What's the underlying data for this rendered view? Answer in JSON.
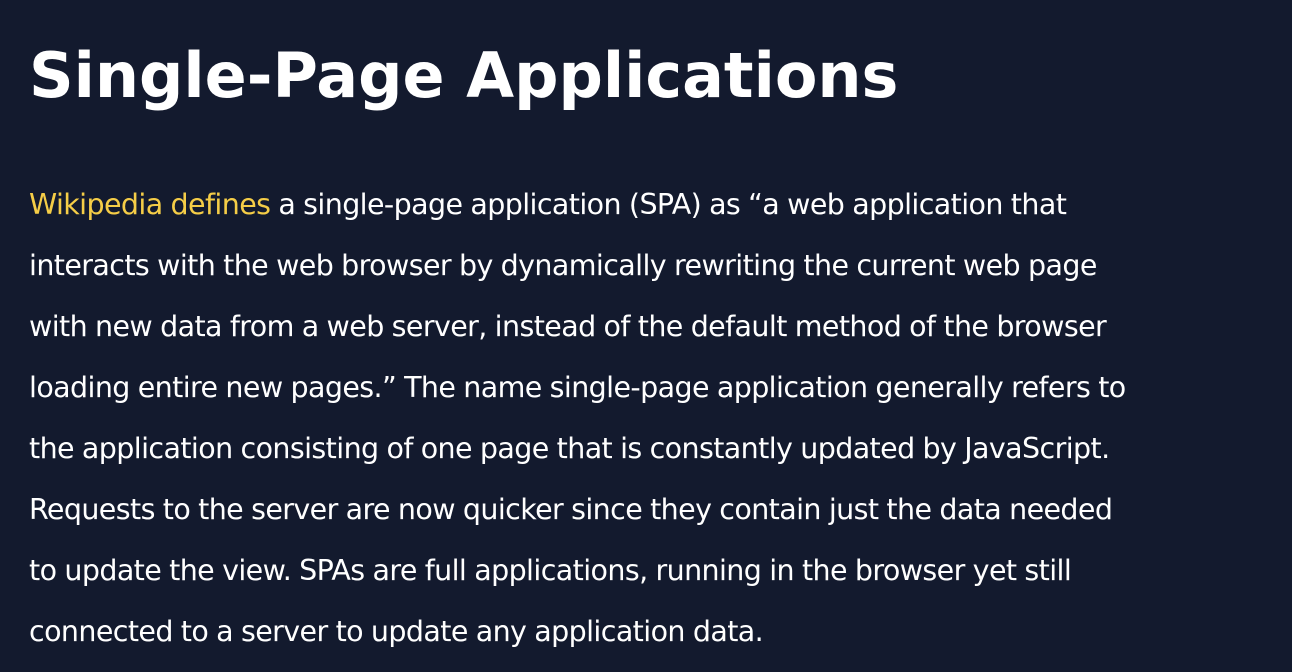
{
  "article": {
    "title": "Single-Page Applications",
    "link_text": "Wikipedia defines",
    "lines": [
      " a single-page application (SPA) as “a web application that",
      "interacts with the web browser by dynamically rewriting the current web page",
      "with new data from a web server, instead of the default method of the browser",
      "loading entire new pages.” The name single-page application generally refers to",
      "the application consisting of one page that is constantly updated by JavaScript.",
      "Requests to the server are now quicker since they contain just the data needed",
      "to update the view. SPAs are full applications, running in the browser yet still",
      "connected to a server to update any application data."
    ]
  },
  "colors": {
    "background": "#131a2e",
    "text": "#ffffff",
    "link": "#f5cd47"
  }
}
